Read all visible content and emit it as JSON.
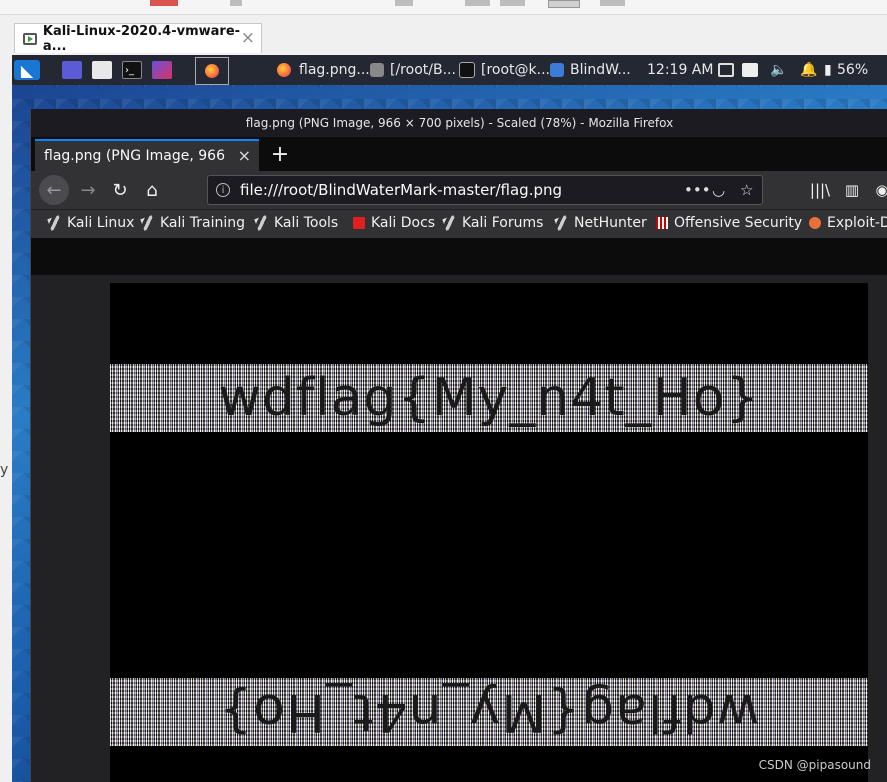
{
  "host": {
    "tab_title": "Kali-Linux-2020.4-vmware-a...",
    "tab_close": "×",
    "edge_glyph": "y"
  },
  "panel": {
    "tasks": [
      {
        "label": "flag.png..."
      },
      {
        "label": "[/root/B..."
      },
      {
        "label": "[root@k..."
      },
      {
        "label": "BlindW..."
      }
    ],
    "clock": "12:19 AM",
    "battery": "56%"
  },
  "firefox": {
    "window_title": "flag.png (PNG Image, 966 × 700 pixels) - Scaled (78%) - Mozilla Firefox",
    "tab_label": "flag.png (PNG Image, 966",
    "tab_close": "×",
    "new_tab": "+",
    "url": "file:///root/BlindWaterMark-master/flag.png",
    "bookmarks": [
      {
        "label": "Kali Linux",
        "icon": "dragon"
      },
      {
        "label": "Kali Training",
        "icon": "dragon"
      },
      {
        "label": "Kali Tools",
        "icon": "dragon"
      },
      {
        "label": "Kali Docs",
        "icon": "pdf"
      },
      {
        "label": "Kali Forums",
        "icon": "dragon"
      },
      {
        "label": "NetHunter",
        "icon": "dragon"
      },
      {
        "label": "Offensive Security",
        "icon": "os"
      },
      {
        "label": "Exploit-D",
        "icon": "ex"
      }
    ]
  },
  "image": {
    "watermark_top": "wdflag{My_n4t_Ho}",
    "watermark_bottom": "wdflag{My_n4t_Ho}"
  },
  "credit": "CSDN @pipasound"
}
